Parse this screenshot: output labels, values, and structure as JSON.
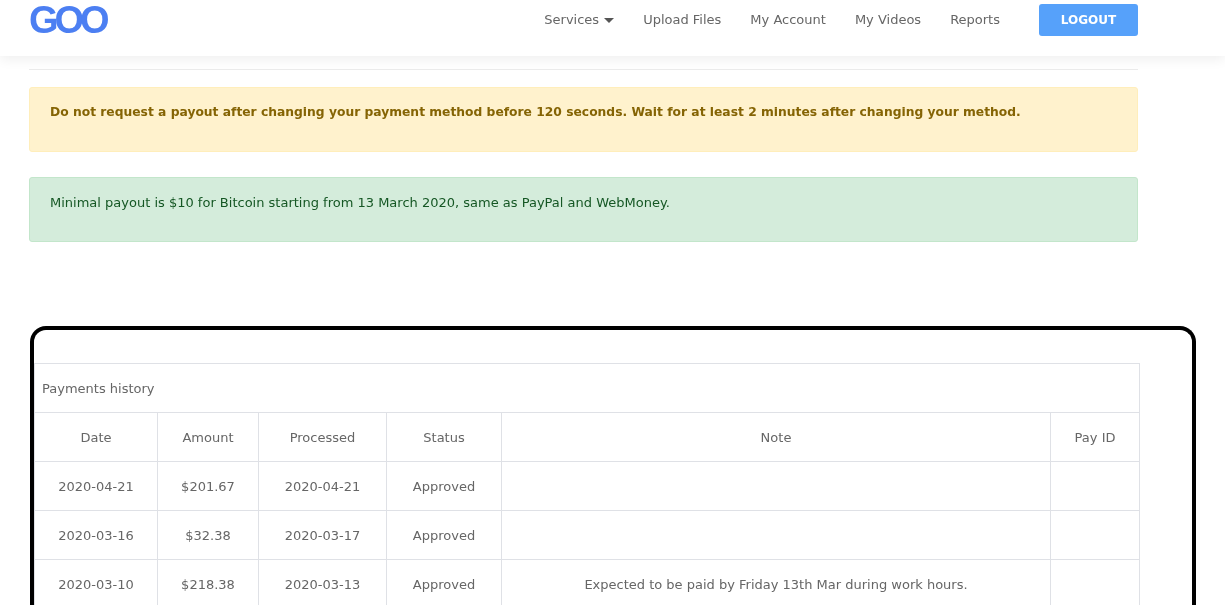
{
  "header": {
    "logo": "GOO",
    "nav": [
      {
        "label": "Services",
        "dropdown": true
      },
      {
        "label": "Upload Files",
        "dropdown": false
      },
      {
        "label": "My Account",
        "dropdown": false
      },
      {
        "label": "My Videos",
        "dropdown": false
      },
      {
        "label": "Reports",
        "dropdown": false
      }
    ],
    "logout_button": "LOGOUT"
  },
  "alerts": [
    {
      "kind": "warning",
      "text": "Do not request a payout after changing your payment method before 120 seconds. Wait for at least 2 minutes after changing your method."
    },
    {
      "kind": "success",
      "text": "Minimal payout is $10 for Bitcoin starting from 13 March 2020, same as PayPal and WebMoney."
    }
  ],
  "payments_table": {
    "caption": "Payments history",
    "columns": [
      "Date",
      "Amount",
      "Processed",
      "Status",
      "Note",
      "Pay ID"
    ],
    "rows": [
      {
        "date": "2020-04-21",
        "amount": "$201.67",
        "processed": "2020-04-21",
        "status": "Approved"
      },
      {
        "date": "2020-03-16",
        "amount": "$32.38",
        "processed": "2020-03-17",
        "status": "Approved"
      },
      {
        "date": "2020-03-10",
        "amount": "$218.38",
        "processed": "2020-03-13",
        "status": "Approved",
        "note": "Expected to be paid by Friday 13th Mar during work hours."
      }
    ]
  }
}
